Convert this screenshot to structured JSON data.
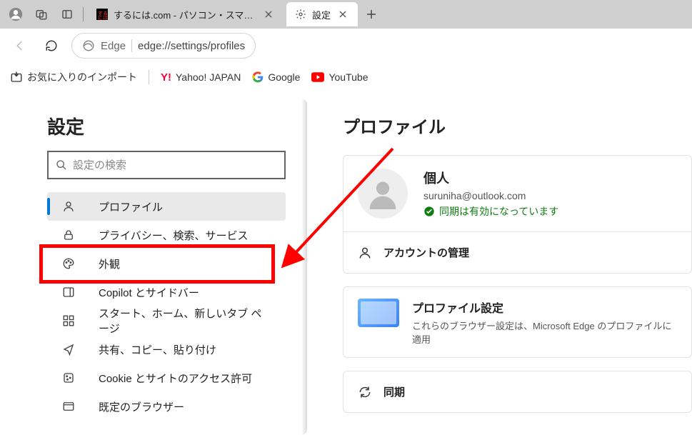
{
  "tabs": {
    "tab1_title": "するには.com - パソコン・スマホの疑問",
    "tab2_title": "設定"
  },
  "toolbar": {
    "edge_label": "Edge",
    "url": "edge://settings/profiles"
  },
  "favbar": {
    "import_label": "お気に入りのインポート",
    "yahoo": "Yahoo! JAPAN",
    "google": "Google",
    "youtube": "YouTube"
  },
  "sidebar": {
    "heading": "設定",
    "search_placeholder": "設定の検索",
    "items": [
      {
        "label": "プロファイル"
      },
      {
        "label": "プライバシー、検索、サービス"
      },
      {
        "label": "外観"
      },
      {
        "label": "Copilot とサイドバー"
      },
      {
        "label": "スタート、ホーム、新しいタブ ページ"
      },
      {
        "label": "共有、コピー、貼り付け"
      },
      {
        "label": "Cookie とサイトのアクセス許可"
      },
      {
        "label": "既定のブラウザー"
      }
    ]
  },
  "main": {
    "title": "プロファイル",
    "profile_name": "個人",
    "profile_email": "suruniha@outlook.com",
    "sync_status": "同期は有効になっています",
    "account_manage": "アカウントの管理",
    "profile_settings_title": "プロファイル設定",
    "profile_settings_sub": "これらのブラウザー設定は、Microsoft Edge のプロファイルに適用",
    "sync_label": "同期"
  }
}
